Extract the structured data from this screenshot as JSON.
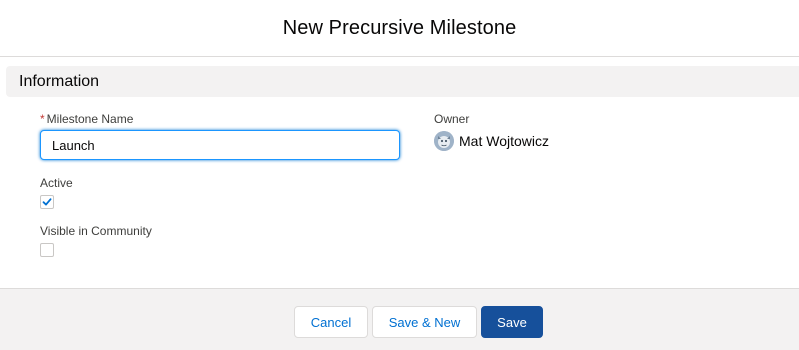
{
  "modal": {
    "title": "New Precursive Milestone"
  },
  "section": {
    "title": "Information"
  },
  "fields": {
    "milestone_name": {
      "required_marker": "*",
      "label": "Milestone Name",
      "value": "Launch"
    },
    "owner": {
      "label": "Owner",
      "value": "Mat Wojtowicz",
      "avatar_icon": "user-avatar-icon"
    },
    "active": {
      "label": "Active",
      "checked": true
    },
    "visible_in_community": {
      "label": "Visible in Community",
      "checked": false
    }
  },
  "footer": {
    "cancel_label": "Cancel",
    "save_new_label": "Save & New",
    "save_label": "Save"
  },
  "colors": {
    "brand": "#16509b",
    "link": "#0070d2",
    "required": "#c23934",
    "focus_border": "#1b96ff",
    "section_bg": "#f3f2f2"
  }
}
